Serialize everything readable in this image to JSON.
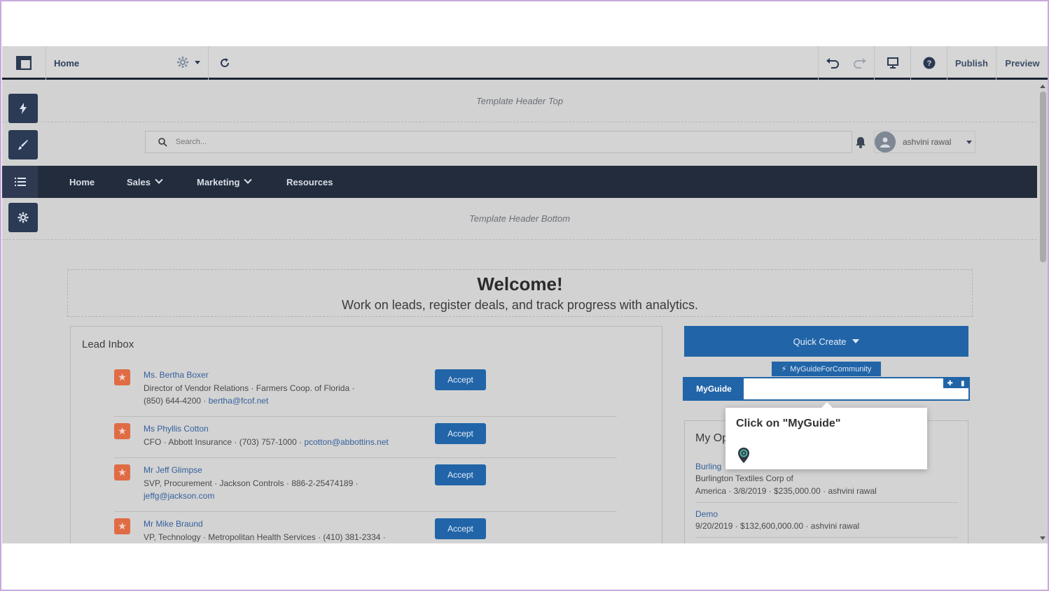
{
  "toolbar": {
    "page_name": "Home",
    "publish_label": "Publish",
    "preview_label": "Preview"
  },
  "canvas": {
    "header_top_label": "Template Header Top",
    "header_bottom_label": "Template Header Bottom",
    "search_placeholder": "Search...",
    "user_name": "ashvini rawal"
  },
  "nav": {
    "items": [
      {
        "label": "Home"
      },
      {
        "label": "Sales"
      },
      {
        "label": "Marketing"
      },
      {
        "label": "Resources"
      }
    ]
  },
  "welcome": {
    "title": "Welcome!",
    "subtitle": "Work on leads, register deals, and track progress with analytics."
  },
  "lead_inbox": {
    "title": "Lead Inbox",
    "accept_label": "Accept",
    "leads": [
      {
        "name": "Ms. Bertha Boxer",
        "line1": "Director of Vendor Relations  ·  Farmers Coop. of Florida  ·",
        "line2_text": "(850) 644-4200  ·  ",
        "email": "bertha@fcof.net"
      },
      {
        "name": "Ms Phyllis Cotton",
        "line1": "CFO  ·  Abbott Insurance  ·  (703) 757-1000  ·  ",
        "email": "pcotton@abbottins.net"
      },
      {
        "name": "Mr Jeff Glimpse",
        "line1": "SVP, Procurement  ·  Jackson Controls  ·  886-2-25474189  ·",
        "email": "jeffg@jackson.com"
      },
      {
        "name": "Mr Mike Braund",
        "line1": "VP, Technology  ·  Metropolitan Health Services  ·  (410) 381-2334  ·"
      }
    ]
  },
  "sidebar": {
    "quick_create_label": "Quick Create",
    "component_tag": "MyGuideForCommunity",
    "myguide_label": "MyGuide",
    "opportunities_title": "My Op",
    "opportunities": [
      {
        "link": "Burling",
        "detail1": "Burlington Textiles Corp of",
        "detail2": "America · 3/8/2019 · $235,000.00 · ashvini rawal"
      },
      {
        "link": "Demo",
        "detail1": "9/20/2019 · $132,600,000.00 · ashvini rawal"
      }
    ]
  },
  "tooltip": {
    "text": "Click on \"MyGuide\""
  },
  "colors": {
    "accent_blue": "#2165a8",
    "nav_dark": "#232c3d",
    "lead_orange": "#e06c46"
  }
}
